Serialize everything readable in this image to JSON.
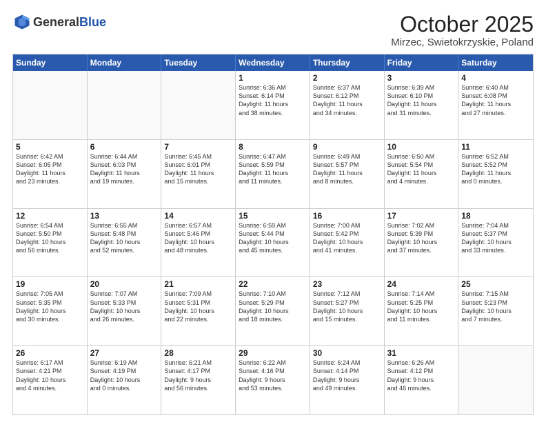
{
  "header": {
    "logo_general": "General",
    "logo_blue": "Blue",
    "month": "October 2025",
    "location": "Mirzec, Swietokrzyskie, Poland"
  },
  "days_of_week": [
    "Sunday",
    "Monday",
    "Tuesday",
    "Wednesday",
    "Thursday",
    "Friday",
    "Saturday"
  ],
  "weeks": [
    [
      {
        "day": "",
        "info": ""
      },
      {
        "day": "",
        "info": ""
      },
      {
        "day": "",
        "info": ""
      },
      {
        "day": "1",
        "info": "Sunrise: 6:36 AM\nSunset: 6:14 PM\nDaylight: 11 hours\nand 38 minutes."
      },
      {
        "day": "2",
        "info": "Sunrise: 6:37 AM\nSunset: 6:12 PM\nDaylight: 11 hours\nand 34 minutes."
      },
      {
        "day": "3",
        "info": "Sunrise: 6:39 AM\nSunset: 6:10 PM\nDaylight: 11 hours\nand 31 minutes."
      },
      {
        "day": "4",
        "info": "Sunrise: 6:40 AM\nSunset: 6:08 PM\nDaylight: 11 hours\nand 27 minutes."
      }
    ],
    [
      {
        "day": "5",
        "info": "Sunrise: 6:42 AM\nSunset: 6:05 PM\nDaylight: 11 hours\nand 23 minutes."
      },
      {
        "day": "6",
        "info": "Sunrise: 6:44 AM\nSunset: 6:03 PM\nDaylight: 11 hours\nand 19 minutes."
      },
      {
        "day": "7",
        "info": "Sunrise: 6:45 AM\nSunset: 6:01 PM\nDaylight: 11 hours\nand 15 minutes."
      },
      {
        "day": "8",
        "info": "Sunrise: 6:47 AM\nSunset: 5:59 PM\nDaylight: 11 hours\nand 11 minutes."
      },
      {
        "day": "9",
        "info": "Sunrise: 6:49 AM\nSunset: 5:57 PM\nDaylight: 11 hours\nand 8 minutes."
      },
      {
        "day": "10",
        "info": "Sunrise: 6:50 AM\nSunset: 5:54 PM\nDaylight: 11 hours\nand 4 minutes."
      },
      {
        "day": "11",
        "info": "Sunrise: 6:52 AM\nSunset: 5:52 PM\nDaylight: 11 hours\nand 0 minutes."
      }
    ],
    [
      {
        "day": "12",
        "info": "Sunrise: 6:54 AM\nSunset: 5:50 PM\nDaylight: 10 hours\nand 56 minutes."
      },
      {
        "day": "13",
        "info": "Sunrise: 6:55 AM\nSunset: 5:48 PM\nDaylight: 10 hours\nand 52 minutes."
      },
      {
        "day": "14",
        "info": "Sunrise: 6:57 AM\nSunset: 5:46 PM\nDaylight: 10 hours\nand 48 minutes."
      },
      {
        "day": "15",
        "info": "Sunrise: 6:59 AM\nSunset: 5:44 PM\nDaylight: 10 hours\nand 45 minutes."
      },
      {
        "day": "16",
        "info": "Sunrise: 7:00 AM\nSunset: 5:42 PM\nDaylight: 10 hours\nand 41 minutes."
      },
      {
        "day": "17",
        "info": "Sunrise: 7:02 AM\nSunset: 5:39 PM\nDaylight: 10 hours\nand 37 minutes."
      },
      {
        "day": "18",
        "info": "Sunrise: 7:04 AM\nSunset: 5:37 PM\nDaylight: 10 hours\nand 33 minutes."
      }
    ],
    [
      {
        "day": "19",
        "info": "Sunrise: 7:05 AM\nSunset: 5:35 PM\nDaylight: 10 hours\nand 30 minutes."
      },
      {
        "day": "20",
        "info": "Sunrise: 7:07 AM\nSunset: 5:33 PM\nDaylight: 10 hours\nand 26 minutes."
      },
      {
        "day": "21",
        "info": "Sunrise: 7:09 AM\nSunset: 5:31 PM\nDaylight: 10 hours\nand 22 minutes."
      },
      {
        "day": "22",
        "info": "Sunrise: 7:10 AM\nSunset: 5:29 PM\nDaylight: 10 hours\nand 18 minutes."
      },
      {
        "day": "23",
        "info": "Sunrise: 7:12 AM\nSunset: 5:27 PM\nDaylight: 10 hours\nand 15 minutes."
      },
      {
        "day": "24",
        "info": "Sunrise: 7:14 AM\nSunset: 5:25 PM\nDaylight: 10 hours\nand 11 minutes."
      },
      {
        "day": "25",
        "info": "Sunrise: 7:15 AM\nSunset: 5:23 PM\nDaylight: 10 hours\nand 7 minutes."
      }
    ],
    [
      {
        "day": "26",
        "info": "Sunrise: 6:17 AM\nSunset: 4:21 PM\nDaylight: 10 hours\nand 4 minutes."
      },
      {
        "day": "27",
        "info": "Sunrise: 6:19 AM\nSunset: 4:19 PM\nDaylight: 10 hours\nand 0 minutes."
      },
      {
        "day": "28",
        "info": "Sunrise: 6:21 AM\nSunset: 4:17 PM\nDaylight: 9 hours\nand 56 minutes."
      },
      {
        "day": "29",
        "info": "Sunrise: 6:22 AM\nSunset: 4:16 PM\nDaylight: 9 hours\nand 53 minutes."
      },
      {
        "day": "30",
        "info": "Sunrise: 6:24 AM\nSunset: 4:14 PM\nDaylight: 9 hours\nand 49 minutes."
      },
      {
        "day": "31",
        "info": "Sunrise: 6:26 AM\nSunset: 4:12 PM\nDaylight: 9 hours\nand 46 minutes."
      },
      {
        "day": "",
        "info": ""
      }
    ]
  ]
}
